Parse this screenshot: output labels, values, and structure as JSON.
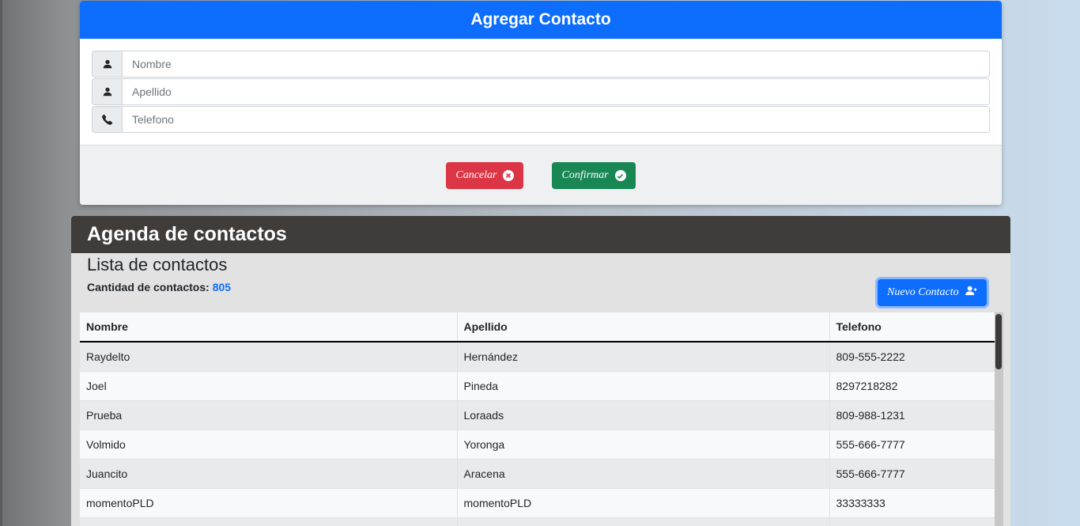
{
  "modal": {
    "title": "Agregar Contacto",
    "fields": [
      {
        "placeholder": "Nombre",
        "icon": "person-icon"
      },
      {
        "placeholder": "Apellido",
        "icon": "person-icon"
      },
      {
        "placeholder": "Telefono",
        "icon": "phone-icon"
      }
    ],
    "cancel_label": "Cancelar",
    "confirm_label": "Confirmar"
  },
  "agenda": {
    "title": "Agenda de contactos",
    "list_title": "Lista de contactos",
    "count_label": "Cantidad de contactos:",
    "count_value": "805",
    "new_button_label": "Nuevo Contacto",
    "columns": [
      "Nombre",
      "Apellido",
      "Telefono"
    ],
    "rows": [
      [
        "Raydelto",
        "Hernández",
        "809-555-2222"
      ],
      [
        "Joel",
        "Pineda",
        "8297218282"
      ],
      [
        "Prueba",
        "Loraads",
        "809-988-1231"
      ],
      [
        "Volmido",
        "Yoronga",
        "555-666-7777"
      ],
      [
        "Juancito",
        "Aracena",
        "555-666-7777"
      ],
      [
        "momentoPLD",
        "momentoPLD",
        "33333333"
      ],
      [
        "",
        "",
        ""
      ]
    ]
  },
  "colors": {
    "primary": "#0d6efd",
    "danger": "#dc3545",
    "success": "#198754",
    "header_dark": "#3f3c3a"
  }
}
